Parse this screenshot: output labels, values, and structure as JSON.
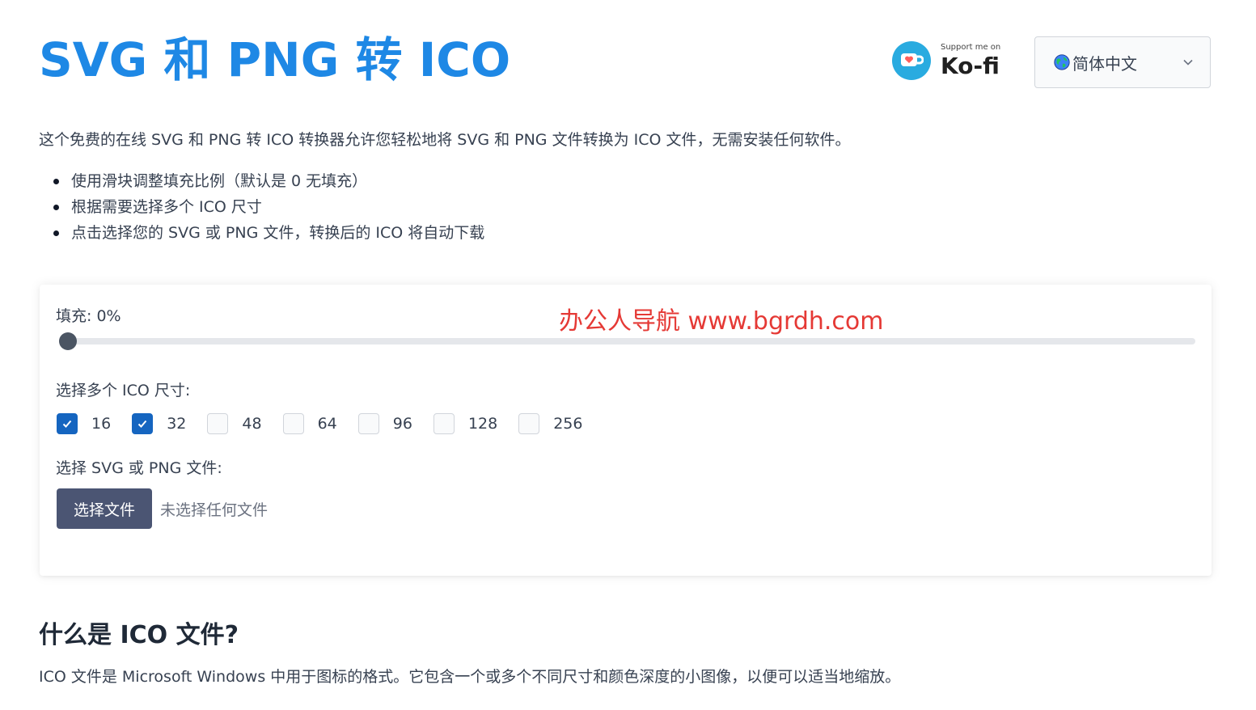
{
  "header": {
    "title": "SVG 和 PNG 转 ICO",
    "kofi": {
      "small_text": "Support me on",
      "brand_text": "Ko-fi",
      "icon": "kofi-cup-icon"
    },
    "language": {
      "icon": "globe-icon",
      "selected": "简体中文"
    }
  },
  "intro": {
    "text": "这个免费的在线 SVG 和 PNG 转 ICO 转换器允许您轻松地将 SVG 和 PNG 文件转换为 ICO 文件，无需安装任何软件。",
    "bullets": [
      "使用滑块调整填充比例（默认是 0 无填充）",
      "根据需要选择多个 ICO 尺寸",
      "点击选择您的 SVG 或 PNG 文件，转换后的 ICO 将自动下载"
    ]
  },
  "converter": {
    "fill_label": "填充: 0%",
    "fill_value_percent": 0,
    "watermark": "办公人导航  www.bgrdh.com",
    "sizes_label": "选择多个 ICO 尺寸:",
    "sizes": [
      {
        "label": "16",
        "checked": true
      },
      {
        "label": "32",
        "checked": true
      },
      {
        "label": "48",
        "checked": false
      },
      {
        "label": "64",
        "checked": false
      },
      {
        "label": "96",
        "checked": false
      },
      {
        "label": "128",
        "checked": false
      },
      {
        "label": "256",
        "checked": false
      }
    ],
    "file_label": "选择 SVG 或 PNG 文件:",
    "file_button": "选择文件",
    "file_status": "未选择任何文件"
  },
  "about": {
    "title": "什么是 ICO 文件?",
    "body": "ICO 文件是 Microsoft Windows 中用于图标的格式。它包含一个或多个不同尺寸和颜色深度的小图像，以便可以适当地缩放。"
  },
  "colors": {
    "title": "#1e88e5",
    "checkbox_checked": "#1565c0",
    "file_button": "#4b5573",
    "watermark": "#e53935",
    "kofi_cup": "#29abe0"
  }
}
